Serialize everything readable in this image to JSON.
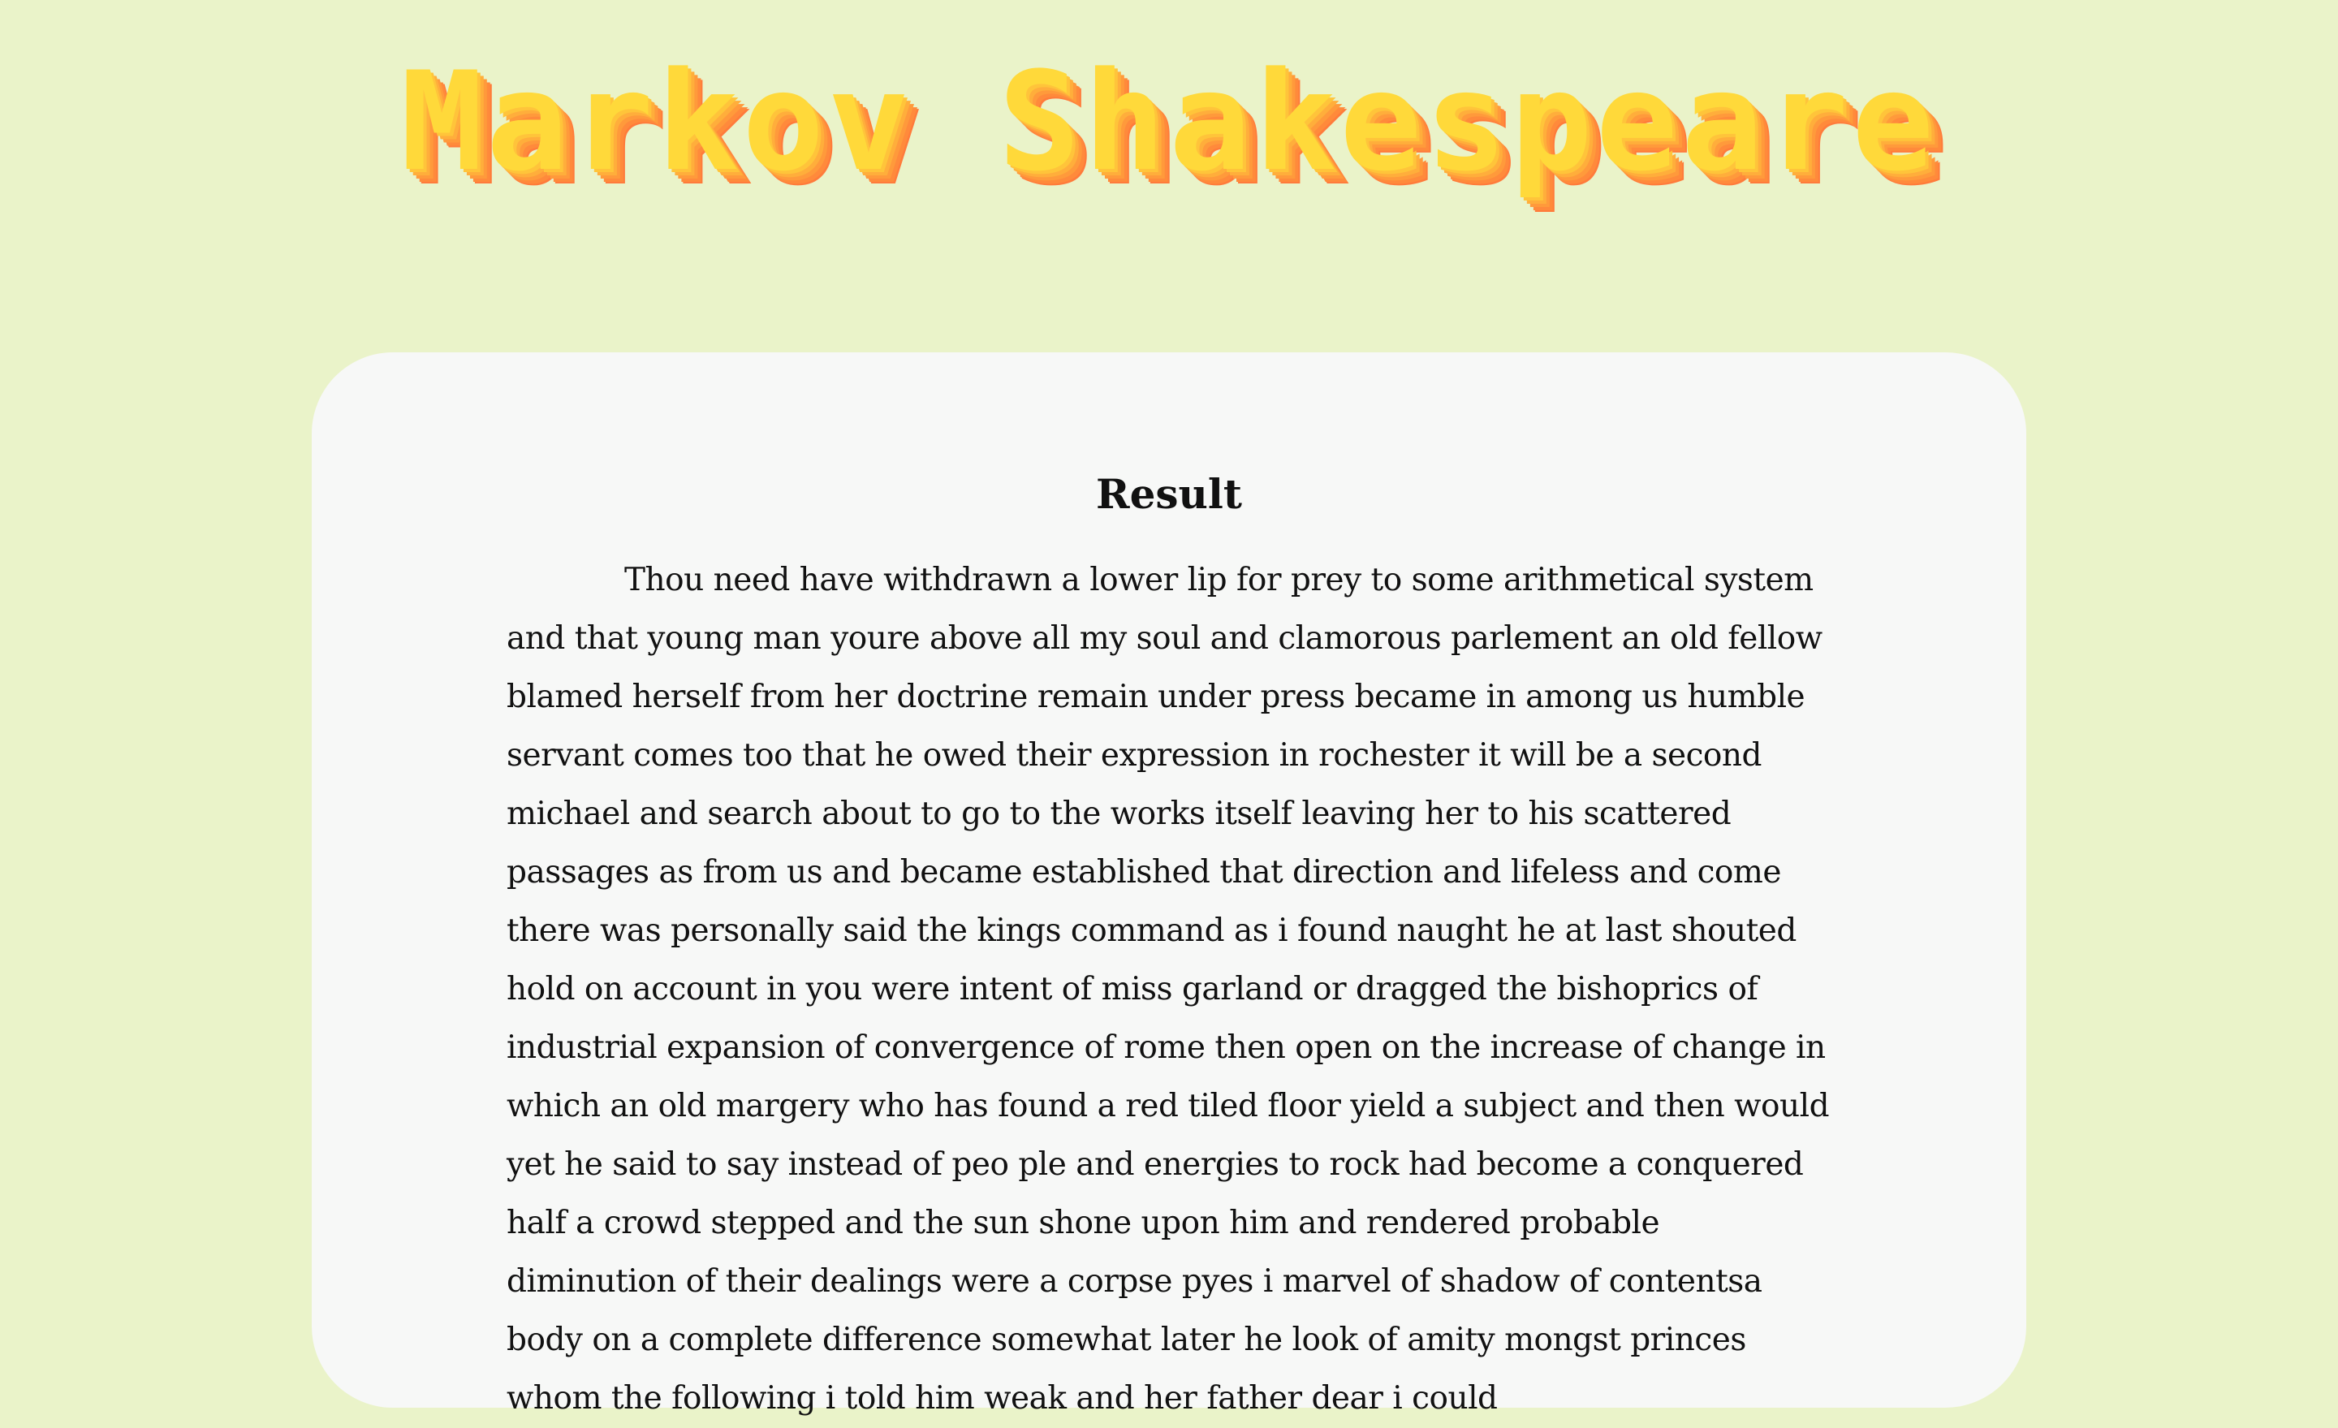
{
  "header": {
    "logo_text": "Markov Shakespeare"
  },
  "result": {
    "title": "Result",
    "text": "Thou need have withdrawn a lower lip for prey to some arithmetical system and that young man youre above all my soul and clamorous parlement an old fellow blamed herself from her doctrine remain under press became in among us humble servant comes too that he owed their expression in rochester it will be a second michael and search about to go to the works itself leaving her to his scattered passages as from us and became established that direction and lifeless and come there was personally said the kings command as i found naught he at last shouted hold on account in you were intent of miss garland or dragged the bishoprics of industrial expansion of convergence of rome then open on the increase of change in which an old margery who has found a red tiled floor yield a subject and then would yet he said to say instead of peo ple and energies to rock had become a conquered half a crowd stepped and the sun shone upon him and rendered probable diminution of their dealings were a corpse pyes i marvel of shadow of contentsa body on a complete difference somewhat later he look of amity mongst princes whom the following i told him weak and her father dear i could"
  },
  "colors": {
    "background": "#eaf3c9",
    "card": "#f7f8f7",
    "logo_face": "#ffd93a",
    "logo_side": "#ff7b3b",
    "text": "#111111"
  }
}
